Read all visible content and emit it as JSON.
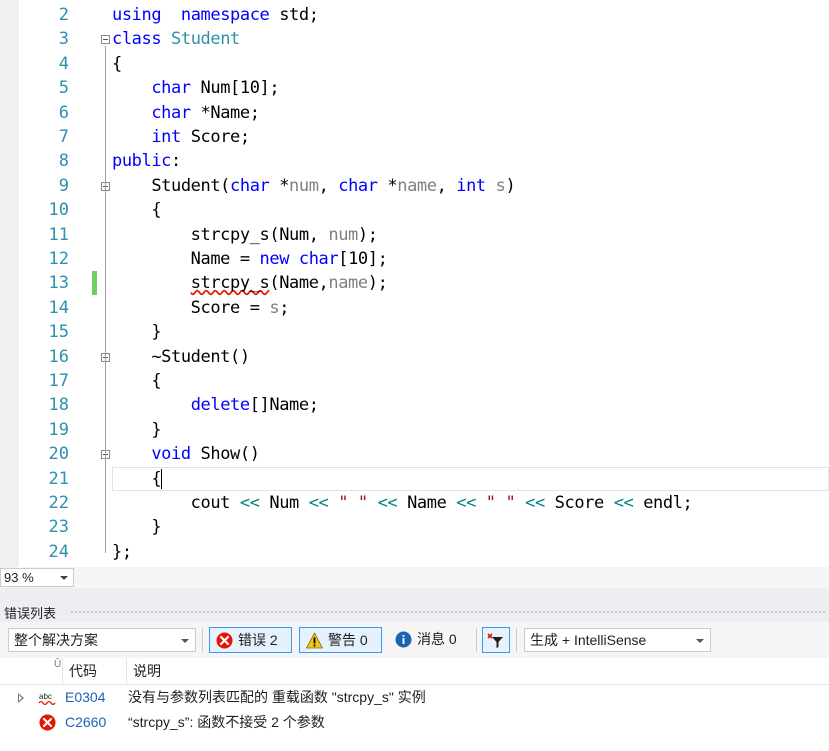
{
  "editor": {
    "lines": [
      {
        "num": "2",
        "tokens": [
          [
            "kw",
            "using"
          ],
          [
            "",
            "  "
          ],
          [
            "kw",
            "namespace"
          ],
          [
            "",
            " std;"
          ]
        ]
      },
      {
        "num": "3",
        "tokens": [
          [
            "kw",
            "class"
          ],
          [
            "",
            " "
          ],
          [
            "ty",
            "Student"
          ]
        ]
      },
      {
        "num": "4",
        "tokens": [
          [
            "",
            "{"
          ]
        ]
      },
      {
        "num": "5",
        "tokens": [
          [
            "",
            "    "
          ],
          [
            "kw",
            "char"
          ],
          [
            "",
            " Num[10];"
          ]
        ]
      },
      {
        "num": "6",
        "tokens": [
          [
            "",
            "    "
          ],
          [
            "kw",
            "char"
          ],
          [
            "",
            " *Name;"
          ]
        ]
      },
      {
        "num": "7",
        "tokens": [
          [
            "",
            "    "
          ],
          [
            "kw",
            "int"
          ],
          [
            "",
            " Score;"
          ]
        ]
      },
      {
        "num": "8",
        "tokens": [
          [
            "kw",
            "public"
          ],
          [
            "",
            ":"
          ]
        ]
      },
      {
        "num": "9",
        "tokens": [
          [
            "",
            "    Student("
          ],
          [
            "kw",
            "char"
          ],
          [
            "",
            " *"
          ],
          [
            "pr",
            "num"
          ],
          [
            "",
            ", "
          ],
          [
            "kw",
            "char"
          ],
          [
            "",
            " *"
          ],
          [
            "pr",
            "name"
          ],
          [
            "",
            ", "
          ],
          [
            "kw",
            "int"
          ],
          [
            "",
            " "
          ],
          [
            "pr",
            "s"
          ],
          [
            "",
            ")"
          ]
        ]
      },
      {
        "num": "10",
        "tokens": [
          [
            "",
            "    {"
          ]
        ]
      },
      {
        "num": "11",
        "tokens": [
          [
            "",
            "        strcpy_s(Num, "
          ],
          [
            "pr",
            "num"
          ],
          [
            "",
            ");"
          ]
        ]
      },
      {
        "num": "12",
        "tokens": [
          [
            "",
            "        Name = "
          ],
          [
            "kw",
            "new"
          ],
          [
            "",
            " "
          ],
          [
            "kw",
            "char"
          ],
          [
            "",
            "[10];"
          ]
        ]
      },
      {
        "num": "13",
        "tokens": [
          [
            "",
            "        "
          ],
          [
            "sq",
            "strcpy_s"
          ],
          [
            "",
            "(Name,"
          ],
          [
            "pr",
            "name"
          ],
          [
            "",
            ");"
          ]
        ]
      },
      {
        "num": "14",
        "tokens": [
          [
            "",
            "        Score = "
          ],
          [
            "pr",
            "s"
          ],
          [
            "",
            ";"
          ]
        ]
      },
      {
        "num": "15",
        "tokens": [
          [
            "",
            "    }"
          ]
        ]
      },
      {
        "num": "16",
        "tokens": [
          [
            "",
            "    ~Student()"
          ]
        ]
      },
      {
        "num": "17",
        "tokens": [
          [
            "",
            "    {"
          ]
        ]
      },
      {
        "num": "18",
        "tokens": [
          [
            "",
            "        "
          ],
          [
            "kw",
            "delete"
          ],
          [
            "",
            "[]Name;"
          ]
        ]
      },
      {
        "num": "19",
        "tokens": [
          [
            "",
            "    }"
          ]
        ]
      },
      {
        "num": "20",
        "tokens": [
          [
            "",
            "    "
          ],
          [
            "kw",
            "void"
          ],
          [
            "",
            " Show()"
          ]
        ]
      },
      {
        "num": "21",
        "tokens": [
          [
            "",
            "    {"
          ]
        ]
      },
      {
        "num": "22",
        "tokens": [
          [
            "",
            "        cout "
          ],
          [
            "op",
            "<<"
          ],
          [
            "",
            " Num "
          ],
          [
            "op",
            "<<"
          ],
          [
            "",
            " "
          ],
          [
            "st",
            "\" \""
          ],
          [
            "",
            " "
          ],
          [
            "op",
            "<<"
          ],
          [
            "",
            " Name "
          ],
          [
            "op",
            "<<"
          ],
          [
            "",
            " "
          ],
          [
            "st",
            "\" \""
          ],
          [
            "",
            " "
          ],
          [
            "op",
            "<<"
          ],
          [
            "",
            " Score "
          ],
          [
            "op",
            "<<"
          ],
          [
            "",
            " endl;"
          ]
        ]
      },
      {
        "num": "23",
        "tokens": [
          [
            "",
            "    }"
          ]
        ]
      },
      {
        "num": "24",
        "tokens": [
          [
            "",
            "};"
          ]
        ]
      }
    ]
  },
  "zoom": {
    "value": "93 %"
  },
  "error_list": {
    "title": "错误列表",
    "scope": "整个解决方案",
    "errors_btn": "错误 2",
    "warnings_btn": "警告 0",
    "messages_btn": "消息 0",
    "source": "生成 + IntelliSense",
    "columns": {
      "code": "代码",
      "description": "说明"
    },
    "rows": [
      {
        "code": "E0304",
        "description": "没有与参数列表匹配的 重载函数 \"strcpy_s\" 实例",
        "icon": "intellisense-abc-icon"
      },
      {
        "code": "C2660",
        "description": "“strcpy_s”: 函数不接受 2 个参数",
        "icon": "error-icon"
      }
    ]
  },
  "colors": {
    "keyword": "#0000ff",
    "type": "#2b91af",
    "param": "#808080",
    "string": "#a31515",
    "error": "#e51400"
  }
}
